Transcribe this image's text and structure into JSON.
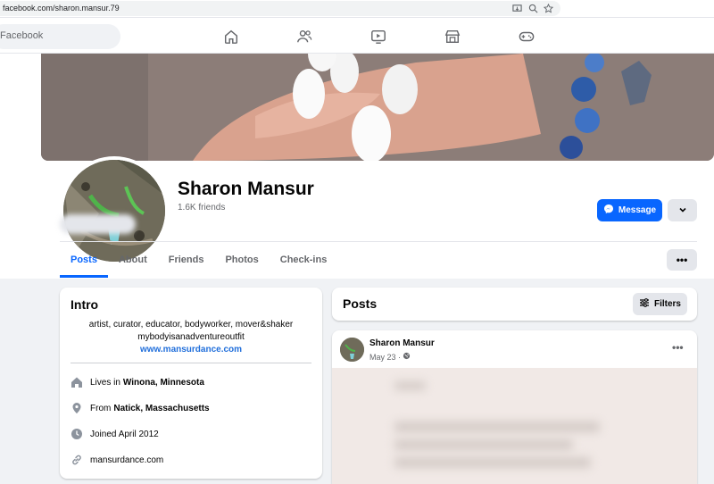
{
  "browser": {
    "url": "facebook.com/sharon.mansur.79"
  },
  "topnav": {
    "search_placeholder": "Facebook"
  },
  "profile": {
    "name": "Sharon Mansur",
    "friends": "1.6K friends",
    "message_label": "Message"
  },
  "tabs": [
    {
      "label": "Posts"
    },
    {
      "label": "About"
    },
    {
      "label": "Friends"
    },
    {
      "label": "Photos"
    },
    {
      "label": "Check-ins"
    }
  ],
  "more_label": "•••",
  "intro": {
    "title": "Intro",
    "bio_line1": "artist, curator, educator, bodyworker, mover&shaker",
    "bio_line2": "mybodyisanadventureoutfit",
    "website_link": "www.mansurdance.com",
    "lives_prefix": "Lives in",
    "lives_place": "Winona, Minnesota",
    "from_prefix": "From",
    "from_place": "Natick, Massachusetts",
    "joined": "Joined April 2012",
    "link": "mansurdance.com"
  },
  "posts": {
    "title": "Posts",
    "filters_label": "Filters",
    "post": {
      "author": "Sharon Mansur",
      "date": "May 23 ·",
      "more": "•••"
    }
  },
  "colors": {
    "accent": "#0866ff",
    "link": "#216fdb",
    "background": "#f0f2f5"
  }
}
